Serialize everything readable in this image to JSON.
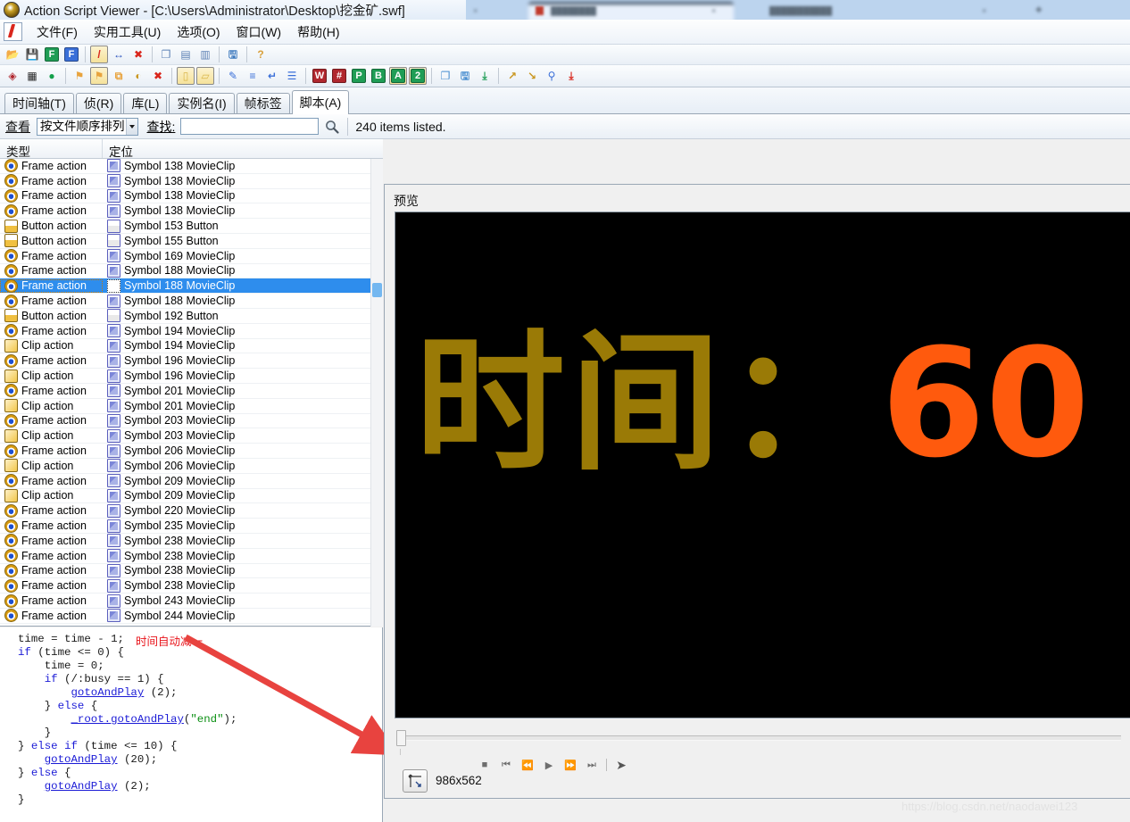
{
  "window": {
    "title": "Action Script Viewer - [C:\\Users\\Administrator\\Desktop\\挖金矿.swf]",
    "app_icon": "asv-disc-icon"
  },
  "menu": {
    "doc_icon": "script-document-icon",
    "items": [
      {
        "label": "文件(F)",
        "name": "menu-file"
      },
      {
        "label": "实用工具(U)",
        "name": "menu-tools"
      },
      {
        "label": "选项(O)",
        "name": "menu-options"
      },
      {
        "label": "窗口(W)",
        "name": "menu-window"
      },
      {
        "label": "帮助(H)",
        "name": "menu-help"
      }
    ]
  },
  "toolbar_top": [
    {
      "name": "open-folder-icon",
      "glyph": "📂",
      "color": "#e8a33d",
      "pressed": false
    },
    {
      "name": "save-icon",
      "glyph": "💾",
      "color": "#4a74c9",
      "pressed": false
    },
    {
      "name": "export-f-green-icon",
      "glyph": "F",
      "color": "#1f9d55",
      "pressed": false
    },
    {
      "name": "export-f-blue-icon",
      "glyph": "F",
      "color": "#3a6fd8",
      "pressed": false
    },
    {
      "sep": true
    },
    {
      "name": "script-pen-icon",
      "glyph": "/",
      "color": "#d9261c",
      "pressed": true
    },
    {
      "name": "resize-arrows-icon",
      "glyph": "↔",
      "color": "#2a52be",
      "pressed": false
    },
    {
      "name": "script-delete-icon",
      "glyph": "✖",
      "color": "#d9261c",
      "pressed": false
    },
    {
      "sep": true
    },
    {
      "name": "copy-window-icon",
      "glyph": "❐",
      "color": "#5e82b5",
      "pressed": false
    },
    {
      "name": "tile-horizontal-icon",
      "glyph": "▤",
      "color": "#5e82b5",
      "pressed": false
    },
    {
      "name": "tile-vertical-icon",
      "glyph": "▥",
      "color": "#5e82b5",
      "pressed": false
    },
    {
      "sep": true
    },
    {
      "name": "save-report-icon",
      "glyph": "🖫",
      "color": "#3f7bbf",
      "pressed": false
    },
    {
      "sep": true
    },
    {
      "name": "help-page-icon",
      "glyph": "?",
      "color": "#d9a13d",
      "pressed": false
    }
  ],
  "toolbar_bottom": [
    {
      "name": "swf-info-icon",
      "glyph": "◈",
      "color": "#b0272e",
      "pressed": false
    },
    {
      "name": "color-palette-icon",
      "glyph": "▦",
      "color": "#2a2a2a",
      "pressed": false
    },
    {
      "name": "color-wheel-icon",
      "glyph": "●",
      "color": "#14a04a",
      "pressed": false
    },
    {
      "sep": true
    },
    {
      "name": "export-tags-icon",
      "glyph": "⚑",
      "color": "#e8a33d",
      "pressed": false
    },
    {
      "name": "export-selected-icon",
      "glyph": "⚑",
      "color": "#e8a33d",
      "pressed": true
    },
    {
      "name": "duplicate-frame-icon",
      "glyph": "⧉",
      "color": "#e8a33d",
      "pressed": false
    },
    {
      "name": "gradient-circle-icon",
      "glyph": "◐",
      "color": "#c9961f",
      "pressed": false
    },
    {
      "name": "remove-color-icon",
      "glyph": "✖",
      "color": "#d9261c",
      "pressed": false
    },
    {
      "sep": true
    },
    {
      "name": "page-white-icon",
      "glyph": "▯",
      "color": "#d9b64a",
      "pressed": true
    },
    {
      "name": "page-note-icon",
      "glyph": "▱",
      "color": "#d9b64a",
      "pressed": true
    },
    {
      "sep": true
    },
    {
      "name": "edit-script-icon",
      "glyph": "✎",
      "color": "#3a6fd8",
      "pressed": false
    },
    {
      "name": "list-lines-icon",
      "glyph": "≡",
      "color": "#3a6fd8",
      "pressed": false
    },
    {
      "name": "wrap-lines-icon",
      "glyph": "↵",
      "color": "#3a6fd8",
      "pressed": false
    },
    {
      "name": "document-lines-icon",
      "glyph": "☰",
      "color": "#3a6fd8",
      "pressed": false
    },
    {
      "sep": true
    },
    {
      "name": "word-wrap-w-icon",
      "glyph": "W",
      "color": "#b0272e",
      "pressed": false
    },
    {
      "name": "line-numbers-hash-icon",
      "glyph": "#",
      "color": "#b0272e",
      "pressed": false
    },
    {
      "name": "pcode-p-icon",
      "glyph": "P",
      "color": "#1f9d55",
      "pressed": false
    },
    {
      "name": "bytecode-b-icon",
      "glyph": "B",
      "color": "#1f9d55",
      "pressed": false
    },
    {
      "name": "actionscript-a-icon",
      "glyph": "A",
      "color": "#1f9d55",
      "pressed": true
    },
    {
      "name": "as2-version-icon",
      "glyph": "2",
      "color": "#1f9d55",
      "pressed": true
    },
    {
      "sep": true
    },
    {
      "name": "copy-script-icon",
      "glyph": "❐",
      "color": "#4a8fd0",
      "pressed": false
    },
    {
      "name": "save-script-icon",
      "glyph": "🖫",
      "color": "#4a8fd0",
      "pressed": false
    },
    {
      "name": "export-all-scripts-icon",
      "glyph": "⤓",
      "color": "#1f9d55",
      "pressed": false
    },
    {
      "sep": true
    },
    {
      "name": "search-script-icon",
      "glyph": "↗",
      "color": "#c9961f",
      "pressed": false
    },
    {
      "name": "replace-script-icon",
      "glyph": "↘",
      "color": "#c9961f",
      "pressed": false
    },
    {
      "name": "zoom-magnifier-icon",
      "glyph": "⚲",
      "color": "#3a6fd8",
      "pressed": false
    },
    {
      "name": "save-as-script-icon",
      "glyph": "⤓",
      "color": "#d9261c",
      "pressed": false
    }
  ],
  "tabs": [
    {
      "label": "时间轴(T)",
      "name": "tab-timeline",
      "active": false
    },
    {
      "label": "侦(R)",
      "name": "tab-detect",
      "active": false
    },
    {
      "label": "库(L)",
      "name": "tab-library",
      "active": false
    },
    {
      "label": "实例名(I)",
      "name": "tab-instance-names",
      "active": false
    },
    {
      "label": "帧标签",
      "name": "tab-frame-labels",
      "active": false
    },
    {
      "label": "脚本(A)",
      "name": "tab-scripts",
      "active": true
    }
  ],
  "viewbar": {
    "view_label": "查看",
    "sort_value": "按文件顺序排列",
    "find_label": "查找:",
    "find_value": "",
    "find_placeholder": "",
    "search_icon": "magnifier-icon",
    "status": "240 items listed."
  },
  "list": {
    "columns": [
      "类型",
      "定位"
    ],
    "rows": [
      {
        "type": "Frame action",
        "type_icon": "frame-action-icon",
        "target": "Symbol 138 MovieClip",
        "target_icon": "movieclip-icon",
        "selected": false
      },
      {
        "type": "Frame action",
        "type_icon": "frame-action-icon",
        "target": "Symbol 138 MovieClip",
        "target_icon": "movieclip-icon",
        "selected": false
      },
      {
        "type": "Frame action",
        "type_icon": "frame-action-icon",
        "target": "Symbol 138 MovieClip",
        "target_icon": "movieclip-icon",
        "selected": false
      },
      {
        "type": "Frame action",
        "type_icon": "frame-action-icon",
        "target": "Symbol 138 MovieClip",
        "target_icon": "movieclip-icon",
        "selected": false
      },
      {
        "type": "Button action",
        "type_icon": "button-action-icon",
        "target": "Symbol 153 Button",
        "target_icon": "button-icon",
        "selected": false
      },
      {
        "type": "Button action",
        "type_icon": "button-action-icon",
        "target": "Symbol 155 Button",
        "target_icon": "button-icon",
        "selected": false
      },
      {
        "type": "Frame action",
        "type_icon": "frame-action-icon",
        "target": "Symbol 169 MovieClip",
        "target_icon": "movieclip-icon",
        "selected": false
      },
      {
        "type": "Frame action",
        "type_icon": "frame-action-icon",
        "target": "Symbol 188 MovieClip",
        "target_icon": "movieclip-icon",
        "selected": false
      },
      {
        "type": "Frame action",
        "type_icon": "frame-action-icon",
        "target": "Symbol 188 MovieClip",
        "target_icon": "movieclip-selected-icon",
        "selected": true
      },
      {
        "type": "Frame action",
        "type_icon": "frame-action-icon",
        "target": "Symbol 188 MovieClip",
        "target_icon": "movieclip-icon",
        "selected": false
      },
      {
        "type": "Button action",
        "type_icon": "button-action-icon",
        "target": "Symbol 192 Button",
        "target_icon": "button-icon",
        "selected": false
      },
      {
        "type": "Frame action",
        "type_icon": "frame-action-icon",
        "target": "Symbol 194 MovieClip",
        "target_icon": "movieclip-icon",
        "selected": false
      },
      {
        "type": "Clip action",
        "type_icon": "clip-action-icon",
        "target": "Symbol 194 MovieClip",
        "target_icon": "movieclip-icon",
        "selected": false
      },
      {
        "type": "Frame action",
        "type_icon": "frame-action-icon",
        "target": "Symbol 196 MovieClip",
        "target_icon": "movieclip-icon",
        "selected": false
      },
      {
        "type": "Clip action",
        "type_icon": "clip-action-icon",
        "target": "Symbol 196 MovieClip",
        "target_icon": "movieclip-icon",
        "selected": false
      },
      {
        "type": "Frame action",
        "type_icon": "frame-action-icon",
        "target": "Symbol 201 MovieClip",
        "target_icon": "movieclip-icon",
        "selected": false
      },
      {
        "type": "Clip action",
        "type_icon": "clip-action-icon",
        "target": "Symbol 201 MovieClip",
        "target_icon": "movieclip-icon",
        "selected": false
      },
      {
        "type": "Frame action",
        "type_icon": "frame-action-icon",
        "target": "Symbol 203 MovieClip",
        "target_icon": "movieclip-icon",
        "selected": false
      },
      {
        "type": "Clip action",
        "type_icon": "clip-action-icon",
        "target": "Symbol 203 MovieClip",
        "target_icon": "movieclip-icon",
        "selected": false
      },
      {
        "type": "Frame action",
        "type_icon": "frame-action-icon",
        "target": "Symbol 206 MovieClip",
        "target_icon": "movieclip-icon",
        "selected": false
      },
      {
        "type": "Clip action",
        "type_icon": "clip-action-icon",
        "target": "Symbol 206 MovieClip",
        "target_icon": "movieclip-icon",
        "selected": false
      },
      {
        "type": "Frame action",
        "type_icon": "frame-action-icon",
        "target": "Symbol 209 MovieClip",
        "target_icon": "movieclip-icon",
        "selected": false
      },
      {
        "type": "Clip action",
        "type_icon": "clip-action-icon",
        "target": "Symbol 209 MovieClip",
        "target_icon": "movieclip-icon",
        "selected": false
      },
      {
        "type": "Frame action",
        "type_icon": "frame-action-icon",
        "target": "Symbol 220 MovieClip",
        "target_icon": "movieclip-icon",
        "selected": false
      },
      {
        "type": "Frame action",
        "type_icon": "frame-action-icon",
        "target": "Symbol 235 MovieClip",
        "target_icon": "movieclip-icon",
        "selected": false
      },
      {
        "type": "Frame action",
        "type_icon": "frame-action-icon",
        "target": "Symbol 238 MovieClip",
        "target_icon": "movieclip-icon",
        "selected": false
      },
      {
        "type": "Frame action",
        "type_icon": "frame-action-icon",
        "target": "Symbol 238 MovieClip",
        "target_icon": "movieclip-icon",
        "selected": false
      },
      {
        "type": "Frame action",
        "type_icon": "frame-action-icon",
        "target": "Symbol 238 MovieClip",
        "target_icon": "movieclip-icon",
        "selected": false
      },
      {
        "type": "Frame action",
        "type_icon": "frame-action-icon",
        "target": "Symbol 238 MovieClip",
        "target_icon": "movieclip-icon",
        "selected": false
      },
      {
        "type": "Frame action",
        "type_icon": "frame-action-icon",
        "target": "Symbol 243 MovieClip",
        "target_icon": "movieclip-icon",
        "selected": false
      },
      {
        "type": "Frame action",
        "type_icon": "frame-action-icon",
        "target": "Symbol 244 MovieClip",
        "target_icon": "movieclip-icon",
        "selected": false
      }
    ]
  },
  "code": {
    "lines": [
      [
        {
          "t": "time = time - 1;",
          "c": "plain"
        }
      ],
      [
        {
          "t": "if",
          "c": "kw"
        },
        {
          "t": " (time <= 0) {",
          "c": "plain"
        }
      ],
      [
        {
          "t": "    time = 0;",
          "c": "plain"
        }
      ],
      [
        {
          "t": "    ",
          "c": "plain"
        },
        {
          "t": "if",
          "c": "kw"
        },
        {
          "t": " (/:busy == 1) {",
          "c": "plain"
        }
      ],
      [
        {
          "t": "        ",
          "c": "plain"
        },
        {
          "t": "gotoAndPlay",
          "c": "fn"
        },
        {
          "t": " (2);",
          "c": "plain"
        }
      ],
      [
        {
          "t": "    } ",
          "c": "plain"
        },
        {
          "t": "else",
          "c": "kw"
        },
        {
          "t": " {",
          "c": "plain"
        }
      ],
      [
        {
          "t": "        ",
          "c": "plain"
        },
        {
          "t": "_root.gotoAndPlay",
          "c": "fn"
        },
        {
          "t": "(",
          "c": "plain"
        },
        {
          "t": "\"end\"",
          "c": "str"
        },
        {
          "t": ");",
          "c": "plain"
        }
      ],
      [
        {
          "t": "    }",
          "c": "plain"
        }
      ],
      [
        {
          "t": "} ",
          "c": "plain"
        },
        {
          "t": "else",
          "c": "kw"
        },
        {
          "t": " ",
          "c": "plain"
        },
        {
          "t": "if",
          "c": "kw"
        },
        {
          "t": " (time <= 10) {",
          "c": "plain"
        }
      ],
      [
        {
          "t": "    ",
          "c": "plain"
        },
        {
          "t": "gotoAndPlay",
          "c": "fn"
        },
        {
          "t": " (20);",
          "c": "plain"
        }
      ],
      [
        {
          "t": "} ",
          "c": "plain"
        },
        {
          "t": "else",
          "c": "kw"
        },
        {
          "t": " {",
          "c": "plain"
        }
      ],
      [
        {
          "t": "    ",
          "c": "plain"
        },
        {
          "t": "gotoAndPlay",
          "c": "fn"
        },
        {
          "t": " (2);",
          "c": "plain"
        }
      ],
      [
        {
          "t": "}",
          "c": "plain"
        }
      ]
    ]
  },
  "annotation": {
    "text": "时间自动减一",
    "color": "#e8131a",
    "arrow_icon": "red-arrow-icon"
  },
  "preview": {
    "label": "预览",
    "stage": {
      "background": "#000000",
      "label_text": "时间：",
      "label_color": "#9a7a06",
      "value_text": "60",
      "value_color": "#ff5a0d"
    },
    "seek": {
      "position": 0
    },
    "transport": [
      {
        "name": "stop-button",
        "glyph": "■"
      },
      {
        "name": "rewind-to-start-button",
        "glyph": "⏮"
      },
      {
        "name": "step-back-button",
        "glyph": "⏪"
      },
      {
        "name": "play-button",
        "glyph": "▶"
      },
      {
        "name": "step-forward-button",
        "glyph": "⏩"
      },
      {
        "name": "go-to-end-button",
        "glyph": "⏭"
      },
      {
        "sep": true
      },
      {
        "name": "flash-player-button",
        "glyph": "➤"
      }
    ],
    "fit_icon": "fit-to-window-icon",
    "size_label": "986x562"
  },
  "watermark": {
    "text": "https://blog.csdn.net/naodawei123"
  },
  "background_browser": {
    "tabs": [
      {
        "title_blur": "■■■■■■",
        "active": true
      },
      {
        "title_blur": "■■■■■■■■■■",
        "active": false
      }
    ]
  }
}
